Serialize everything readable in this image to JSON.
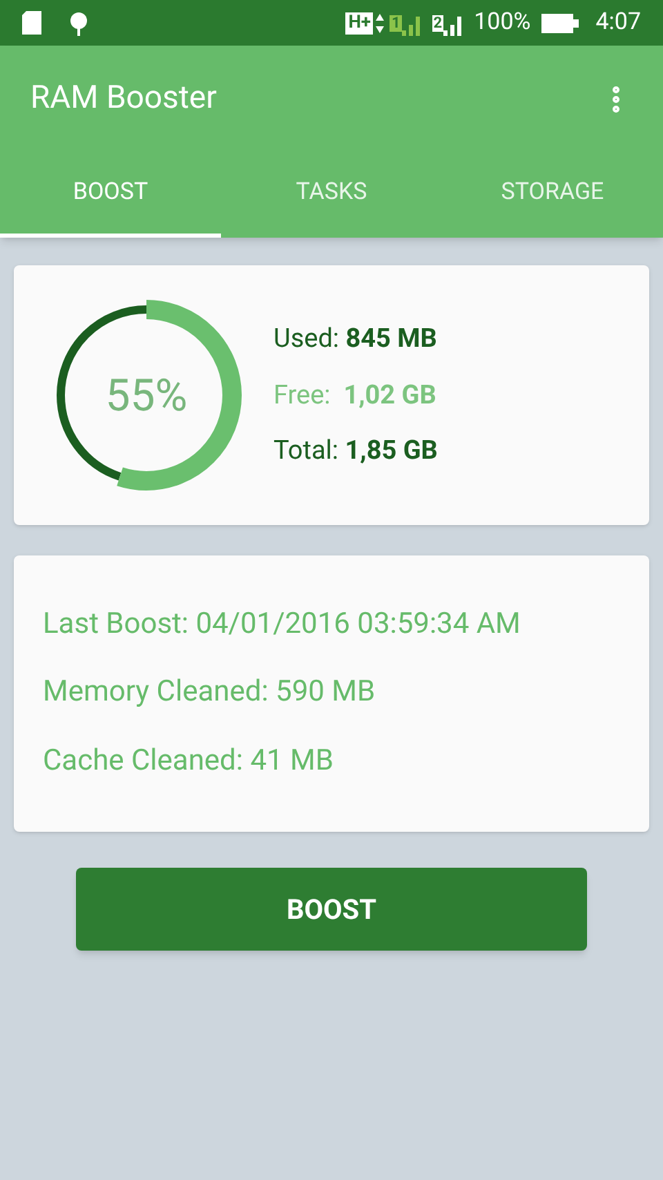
{
  "status_bar": {
    "network_type": "H+",
    "sim_1": "1",
    "sim_2": "2",
    "battery": "100%",
    "time": "4:07"
  },
  "app_bar": {
    "title": "RAM Booster"
  },
  "tabs": [
    {
      "label": "BOOST",
      "selected": true
    },
    {
      "label": "TASKS",
      "selected": false
    },
    {
      "label": "STORAGE",
      "selected": false
    }
  ],
  "memory": {
    "level": 0.55,
    "percent": "55%",
    "stats": [
      {
        "text": "Used: **845 MB**",
        "color": "#1b5e20"
      },
      {
        "text": "Free:  **1,02 GB**",
        "color": "#7cc47f"
      },
      {
        "text": "Total: **1,85 GB**",
        "color": "#1b5e20"
      }
    ]
  },
  "history": [
    "Last Boost: 04/01/2016 03:59:34 AM",
    "Memory Cleaned: 590 MB",
    "Cache Cleaned: 41 MB"
  ],
  "boost_button": "BOOST"
}
